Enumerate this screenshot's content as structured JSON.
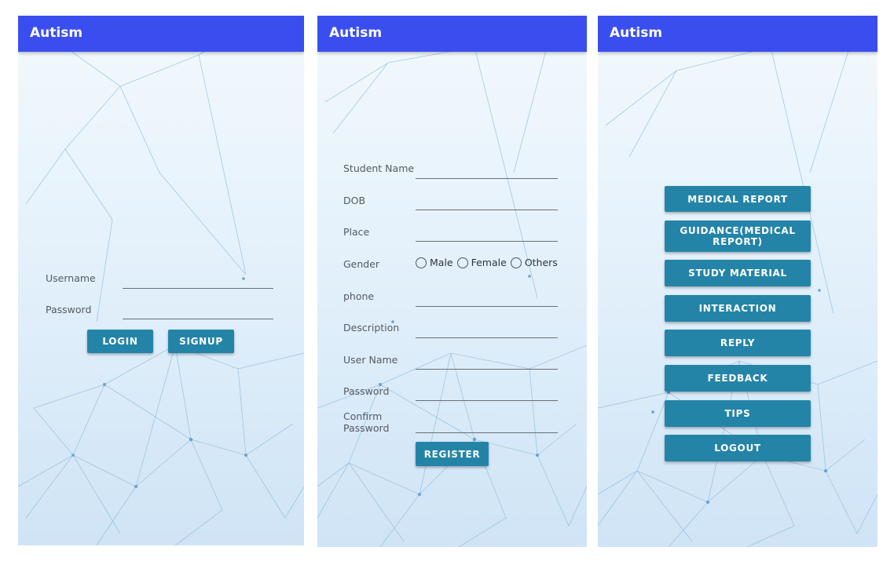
{
  "app": {
    "title": "Autism"
  },
  "login": {
    "username_label": "Username",
    "password_label": "Password",
    "login_button": "LOGIN",
    "signup_button": "SIGNUP"
  },
  "register": {
    "student_name_label": "Student Name",
    "dob_label": "DOB",
    "place_label": "Place",
    "gender_label": "Gender",
    "gender_options": [
      "Male",
      "Female",
      "Others"
    ],
    "phone_label": "phone",
    "description_label": "Description",
    "username_label": "User Name",
    "password_label": "Password",
    "confirm_password_label": "Confirm\nPassword",
    "register_button": "REGISTER"
  },
  "menu": {
    "items": [
      "MEDICAL REPORT",
      "GUIDANCE(MEDICAL REPORT)",
      "STUDY MATERIAL",
      "INTERACTION",
      "REPLY",
      "FEEDBACK",
      "TIPS",
      "LOGOUT"
    ]
  },
  "colors": {
    "appbar": "#3a4ef0",
    "button": "#2484a8",
    "background": "#e4f1fb"
  }
}
